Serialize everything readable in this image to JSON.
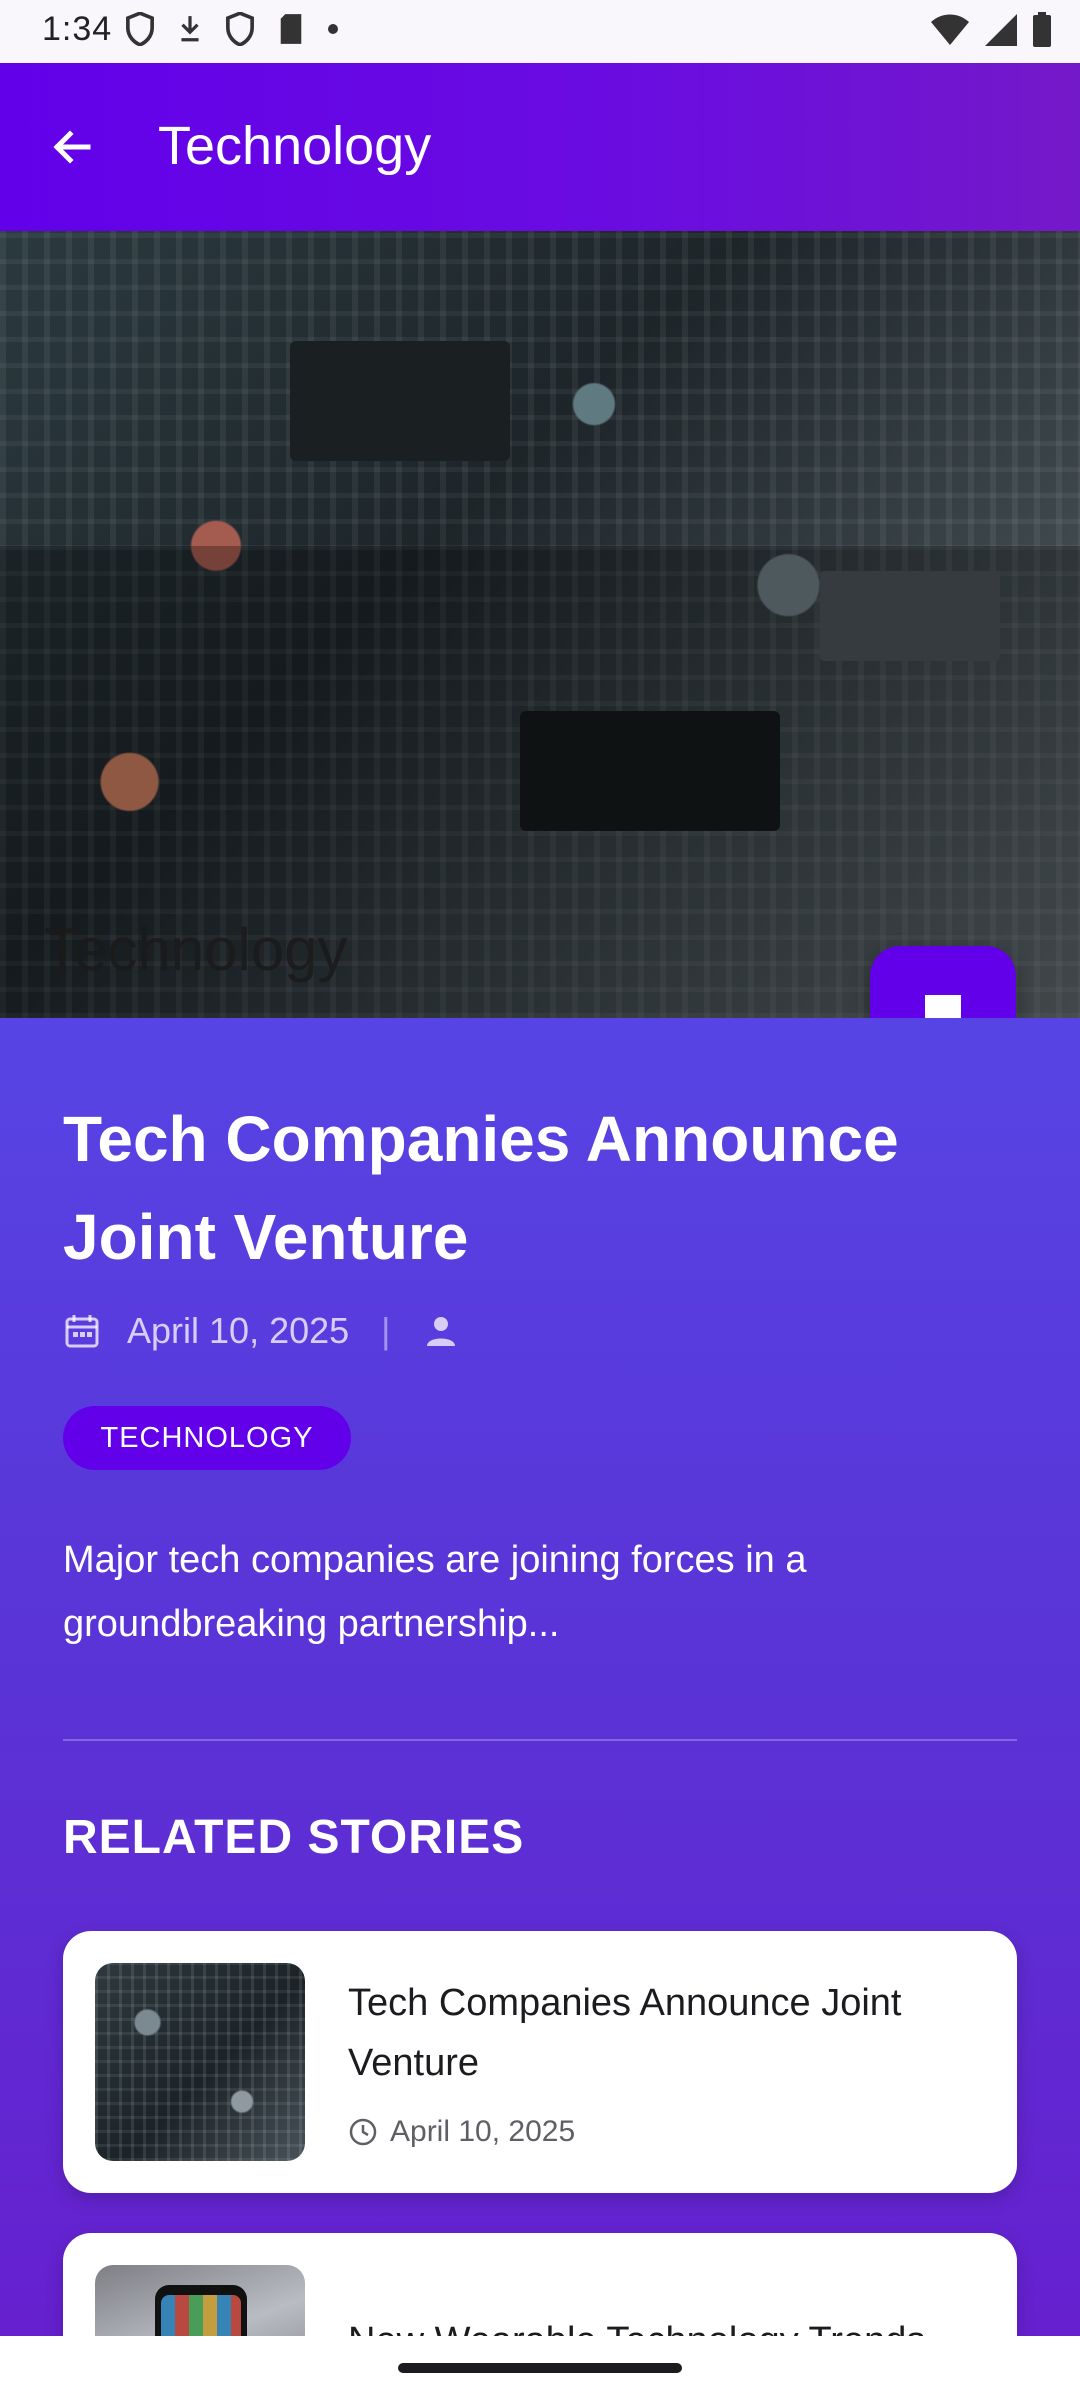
{
  "status_bar": {
    "time": "1:34",
    "left_icons": [
      "shield-icon",
      "download-icon",
      "shield-icon",
      "sd-card-icon",
      "dot-icon"
    ],
    "right_icons": [
      "wifi-icon",
      "signal-icon",
      "battery-icon"
    ]
  },
  "app_bar": {
    "back_icon": "arrow-left-icon",
    "title": "Technology"
  },
  "hero": {
    "image_label": "Technology"
  },
  "fab": {
    "icon": "bookmark-icon"
  },
  "article": {
    "title": "Tech Companies Announce Joint Venture",
    "date": "April 10, 2025",
    "separator": "|",
    "category": "TECHNOLOGY",
    "summary": "Major tech companies are joining forces in a groundbreaking partnership..."
  },
  "related": {
    "heading": "RELATED STORIES",
    "items": [
      {
        "title": "Tech Companies Announce Joint Venture",
        "date": "April 10, 2025"
      },
      {
        "title": "New Wearable Technology Trends"
      }
    ]
  },
  "colors": {
    "primary": "#6200ea",
    "content_bg": "#5a33d6",
    "card_bg": "#ffffff"
  }
}
